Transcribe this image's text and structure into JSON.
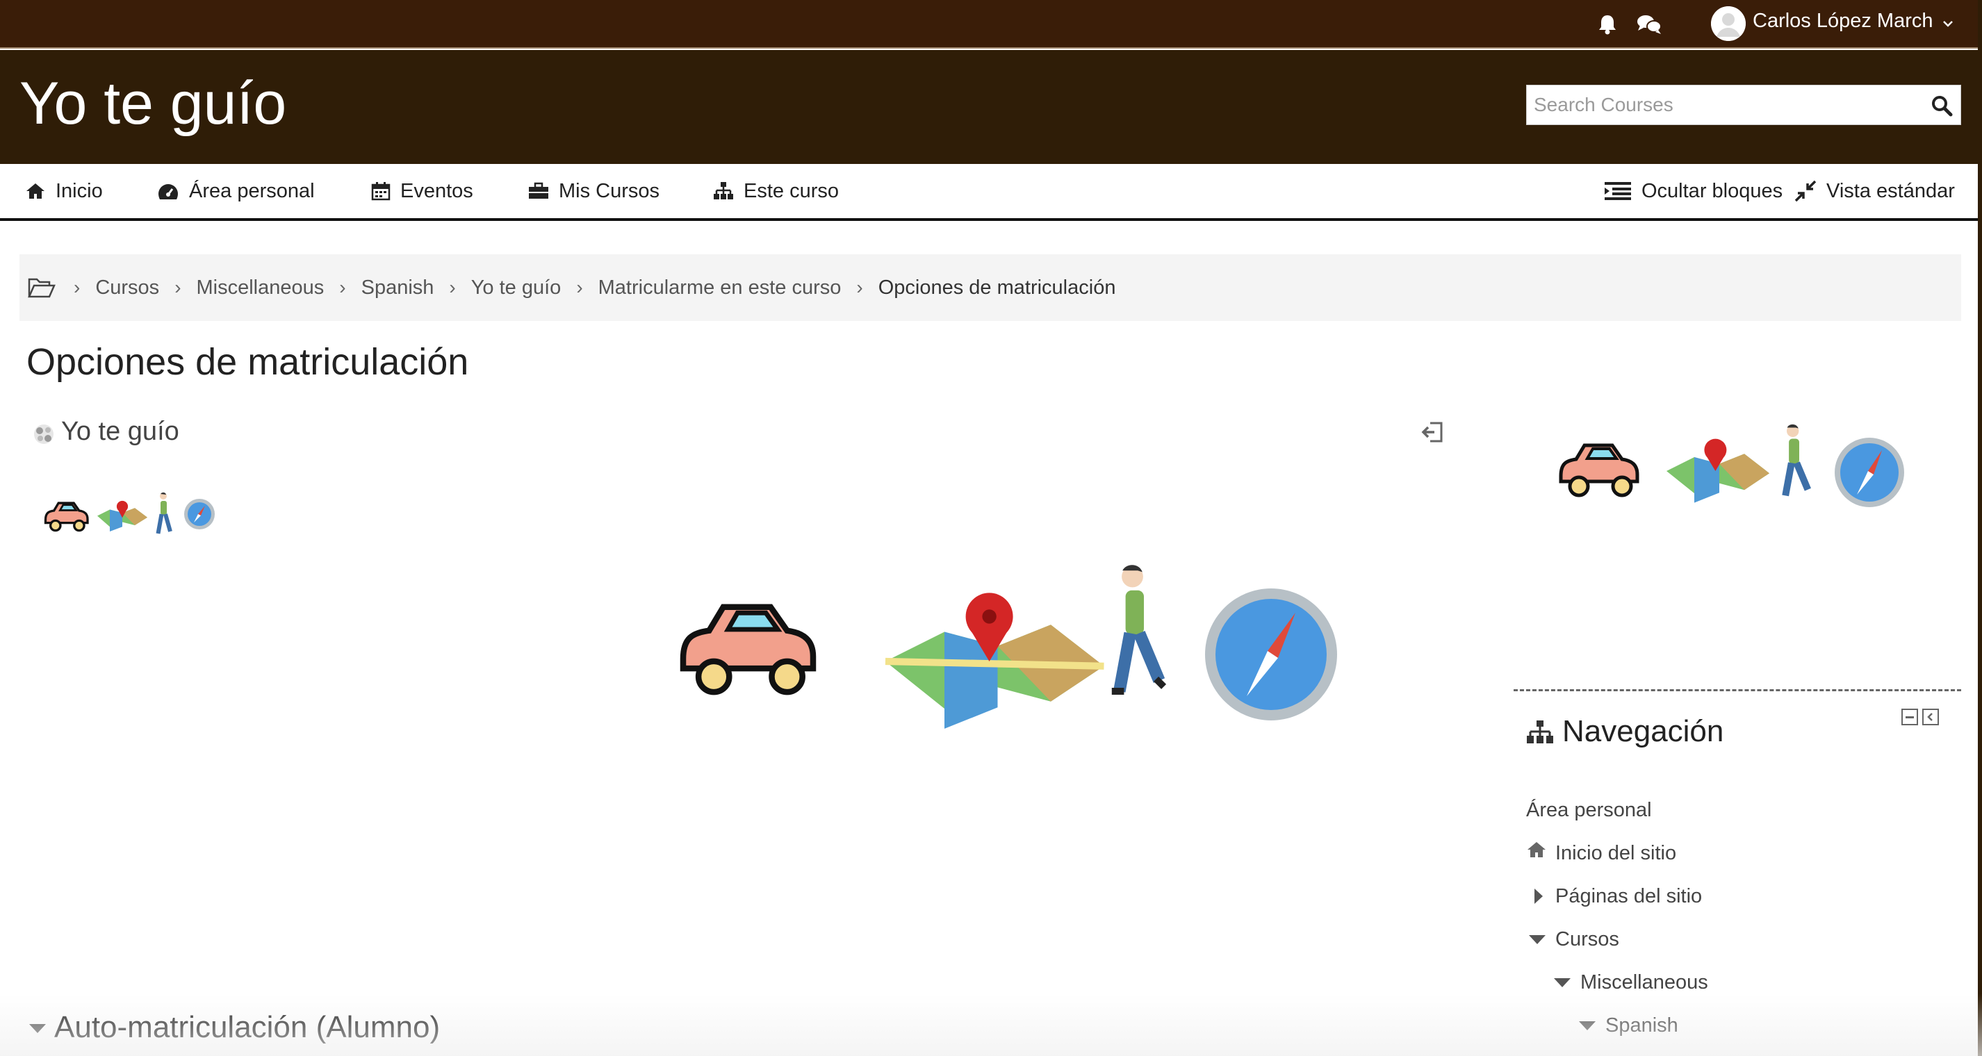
{
  "topbar": {
    "username": "Carlos López March",
    "icons": [
      "bell-icon",
      "chat-icon",
      "avatar",
      "chevron-down-icon"
    ]
  },
  "header": {
    "site_title": "Yo te guío",
    "search_placeholder": "Search Courses"
  },
  "nav": {
    "items": [
      {
        "label": "Inicio",
        "icon": "home-icon"
      },
      {
        "label": "Área personal",
        "icon": "dashboard-icon"
      },
      {
        "label": "Eventos",
        "icon": "calendar-icon"
      },
      {
        "label": "Mis Cursos",
        "icon": "briefcase-icon"
      },
      {
        "label": "Este curso",
        "icon": "sitemap-icon"
      }
    ],
    "hide_blocks": "Ocultar bloques",
    "standard_view": "Vista estándar"
  },
  "breadcrumb": {
    "items": [
      "Cursos",
      "Miscellaneous",
      "Spanish",
      "Yo te guío",
      "Matricularme en este curso"
    ],
    "current": "Opciones de matriculación"
  },
  "main": {
    "page_title": "Opciones de matriculación",
    "course_name": "Yo te guío",
    "section_heading": "Auto-matriculación (Alumno)"
  },
  "nav_block": {
    "title": "Navegación",
    "items": [
      "Área personal",
      "Inicio del sitio",
      "Páginas del sitio",
      "Cursos",
      "Miscellaneous",
      "Spanish"
    ]
  },
  "colors": {
    "topbar": "#3a1d08",
    "header": "#2f1d07",
    "breadcrumb_bg": "#f4f4f4"
  }
}
